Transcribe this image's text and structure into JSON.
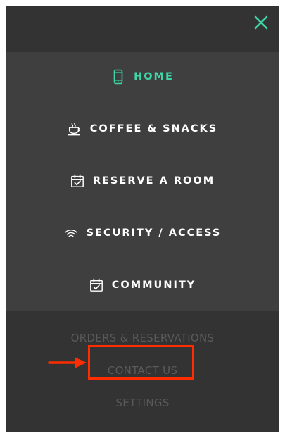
{
  "colors": {
    "accent": "#3ed6a6",
    "menu_text": "#ffffff",
    "secondary_text": "#5a5a5a",
    "annotation": "#ff2d00"
  },
  "close": {
    "icon": "close-icon"
  },
  "menu": {
    "items": [
      {
        "label": "HOME",
        "icon": "phone-icon",
        "active": true
      },
      {
        "label": "COFFEE & SNACKS",
        "icon": "coffee-cup-icon",
        "active": false
      },
      {
        "label": "RESERVE A ROOM",
        "icon": "calendar-check-icon",
        "active": false
      },
      {
        "label": "SECURITY / ACCESS",
        "icon": "wifi-icon",
        "active": false
      },
      {
        "label": "COMMUNITY",
        "icon": "calendar-check-icon",
        "active": false
      }
    ]
  },
  "secondary": {
    "items": [
      {
        "label": "ORDERS & RESERVATIONS"
      },
      {
        "label": "CONTACT US"
      },
      {
        "label": "SETTINGS"
      }
    ]
  },
  "annotation": {
    "target": "CONTACT US",
    "arrow_icon": "right-arrow-icon"
  }
}
